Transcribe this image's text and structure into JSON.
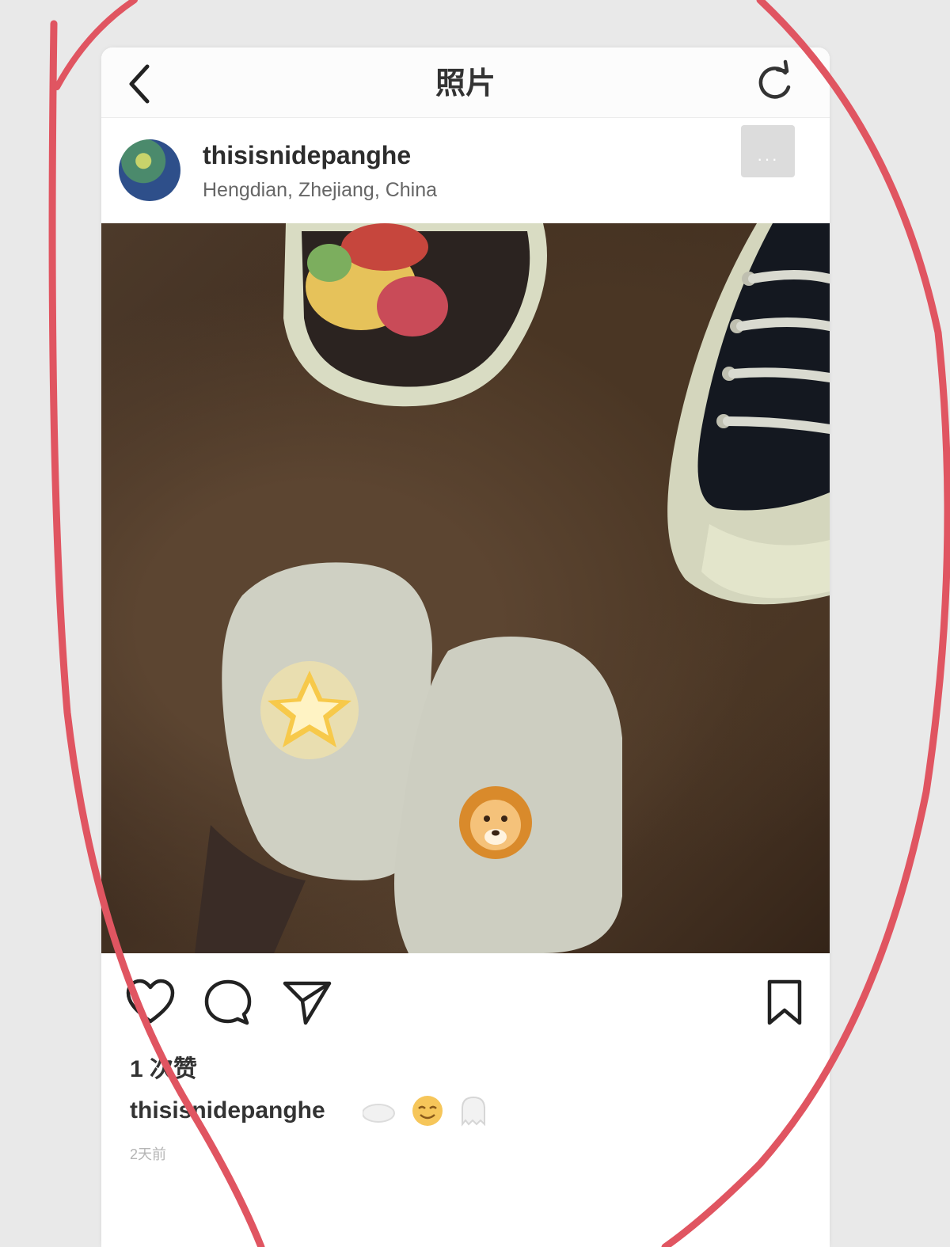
{
  "nav": {
    "title": "照片"
  },
  "post": {
    "username": "thisisnidepanghe",
    "location": "Hengdian, Zhejiang, China",
    "more_label": "···"
  },
  "photo": {
    "stickers": [
      "star-emoji-icon",
      "lion-emoji-icon"
    ]
  },
  "actions": {
    "icons": [
      "heart-icon",
      "comment-icon",
      "share-icon",
      "bookmark-icon"
    ]
  },
  "likes": {
    "text": "1 次赞"
  },
  "caption": {
    "username": "thisisnidepanghe",
    "emojis": [
      "cloud-icon",
      "smile-emoji-icon",
      "ghost-icon"
    ]
  },
  "time": {
    "text": "2天前"
  },
  "colors": {
    "annotation": "#e05561",
    "background": "#e9e9e9"
  }
}
